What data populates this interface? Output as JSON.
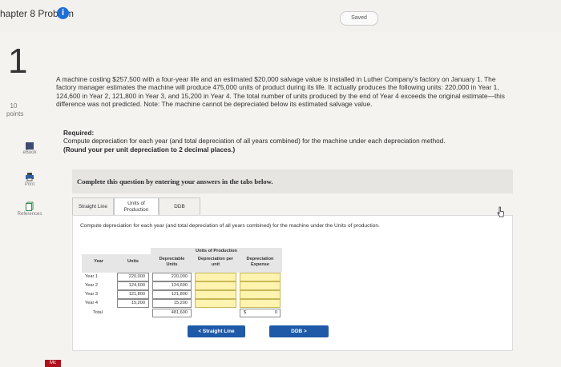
{
  "header": {
    "chapter": "hapter 8 Problem",
    "info_icon": "info-icon",
    "saved": "Saved"
  },
  "question": {
    "number": "1",
    "points_value": "10",
    "points_label": "points"
  },
  "sidebar": {
    "items": [
      {
        "label": "eBook",
        "icon": "book-icon"
      },
      {
        "label": "Print",
        "icon": "print-icon"
      },
      {
        "label": "References",
        "icon": "references-icon"
      }
    ]
  },
  "problem_text": "A machine costing $257,500 with a four-year life and an estimated $20,000 salvage value is installed in Luther Company's factory on January 1. The factory manager estimates the machine will produce 475,000 units of product during its life. It actually produces the following units: 220,000 in Year 1, 124,600 in Year 2, 121,800 in Year 3, and 15,200 in Year 4. The total number of units produced by the end of Year 4 exceeds the original estimate—this difference was not predicted. Note: The machine cannot be depreciated below its estimated salvage value.",
  "required": {
    "title": "Required:",
    "line1": "Compute depreciation for each year (and total depreciation of all years combined) for the machine under each depreciation method.",
    "line2": "(Round your per unit depreciation to 2 decimal places.)"
  },
  "banner": "Complete this question by entering your answers in the tabs below.",
  "tabs": [
    {
      "label": "Straight Line"
    },
    {
      "label": "Units of Production"
    },
    {
      "label": "DDB"
    }
  ],
  "instruction": "Compute depreciation for each year (and total depreciation of all years combined) for the machine under the Units of production.",
  "table": {
    "group_header": "Units of Production",
    "columns": [
      "Year",
      "Units",
      "Depreciable Units",
      "Depreciation per unit",
      "Depreciation Expense"
    ],
    "rows": [
      {
        "year": "Year 1",
        "units": "220,000",
        "dep_units": "220,000",
        "per_unit": "",
        "expense": ""
      },
      {
        "year": "Year 2",
        "units": "124,600",
        "dep_units": "124,600",
        "per_unit": "",
        "expense": ""
      },
      {
        "year": "Year 3",
        "units": "121,800",
        "dep_units": "121,800",
        "per_unit": "",
        "expense": ""
      },
      {
        "year": "Year 4",
        "units": "15,200",
        "dep_units": "15,200",
        "per_unit": "",
        "expense": ""
      }
    ],
    "total": {
      "label": "Total",
      "dep_units": "481,600",
      "currency": "$",
      "expense": "0"
    }
  },
  "nav": {
    "prev": "< Straight Line",
    "next": "DDB >"
  },
  "footer": {
    "logo": "Mc"
  },
  "colors": {
    "accent": "#1e5aa8",
    "input_highlight": "#fff3b0",
    "logo": "#b0101c"
  }
}
